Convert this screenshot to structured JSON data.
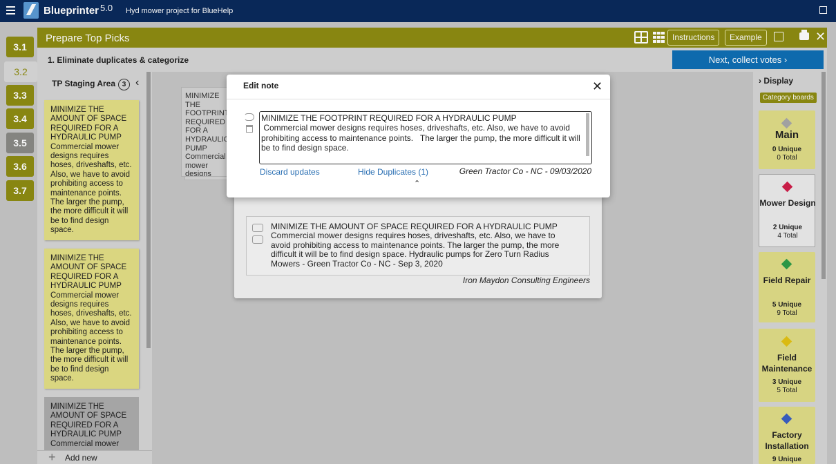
{
  "app": {
    "name": "Blueprinter",
    "version": "5.0",
    "project": "Hyd mower project for BlueHelp"
  },
  "steps": [
    "3.1",
    "3.2",
    "3.3",
    "3.4",
    "3.5",
    "3.6",
    "3.7"
  ],
  "panel": {
    "title": "Prepare Top Picks",
    "instructions_label": "Instructions",
    "example_label": "Example",
    "phase": "1. Eliminate duplicates & categorize",
    "next_label": "Next, collect votes  ›"
  },
  "staging": {
    "title": "TP Staging Area",
    "count": "3",
    "collapse": "‹",
    "add_new": "Add new",
    "notes": [
      "MINIMIZE THE AMOUNT OF SPACE REQUIRED FOR A HYDRAULIC PUMP Commercial mower designs requires hoses, driveshafts, etc. Also, we have to avoid prohibiting access to maintenance points. The larger the pump, the more difficult it will be to find design space.",
      "MINIMIZE THE AMOUNT OF SPACE REQUIRED FOR A HYDRAULIC PUMP Commercial mower designs requires hoses, driveshafts, etc. Also, we have to avoid prohibiting access to maintenance points. The larger the pump, the more difficult it will be to find design space.",
      "MINIMIZE THE AMOUNT OF SPACE REQUIRED FOR A HYDRAULIC PUMP Commercial mower"
    ]
  },
  "canvas": {
    "bg_card": "MINIMIZE THE FOOTPRINT REQUIRED FOR A HYDRAULIC PUMP Commercial mower designs requires hoses, driveshafts, etc. Also, we have to avoid prohibiting"
  },
  "display": {
    "title": "Display",
    "category_label": "Category boards",
    "boards": [
      {
        "name": "Main",
        "unique": "0 Unique",
        "total": "0 Total",
        "color": "#a8a8a8"
      },
      {
        "name": "Mower Design",
        "unique": "2 Unique",
        "total": "4 Total",
        "color": "#d11f4a"
      },
      {
        "name": "Field Repair",
        "unique": "5 Unique",
        "total": "9 Total",
        "color": "#2e9e48"
      },
      {
        "name": "Field Maintenance",
        "unique": "3 Unique",
        "total": "5 Total",
        "color": "#e3c213"
      },
      {
        "name": "Factory Installation",
        "unique": "9 Unique",
        "total": "",
        "color": "#3a5fc4"
      }
    ]
  },
  "modal": {
    "title": "Edit note",
    "close": "✕",
    "text": "MINIMIZE THE FOOTPRINT REQUIRED FOR A HYDRAULIC PUMP\n Commercial mower designs requires hoses, driveshafts, etc. Also, we have to avoid prohibiting access to maintenance points.   The larger the pump, the more difficult it will be to find design space.",
    "discard": "Discard updates",
    "hide_duplicates": "Hide Duplicates (1)",
    "source": "Green Tractor Co - NC - 09/03/2020",
    "collapse_caret": "⌃"
  },
  "duplicate": {
    "text": "MINIMIZE THE AMOUNT OF SPACE REQUIRED FOR A HYDRAULIC PUMP Commercial mower designs requires hoses, driveshafts, etc. Also, we have to avoid prohibiting access to maintenance points. The larger the pump, the more difficult it will be to find design space. Hydraulic pumps for Zero Turn Radius Mowers - Green Tractor Co - NC - Sep 3, 2020",
    "source": "Iron Maydon Consulting Engineers"
  }
}
